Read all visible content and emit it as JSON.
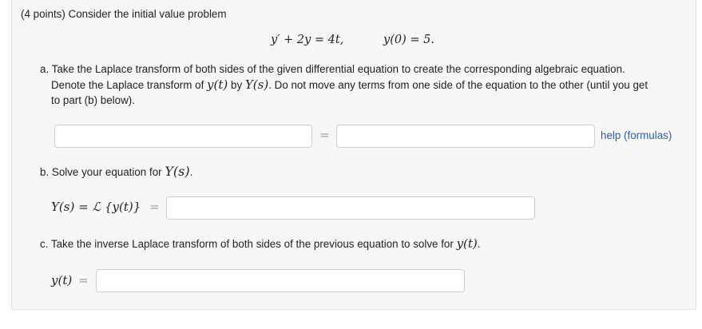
{
  "intro": "(4 points) Consider the initial value problem",
  "ivp": {
    "ode": "y′ + 2y = 4t,",
    "initial": "y(0) = 5."
  },
  "part_a": {
    "line1": "a. Take the Laplace transform of both sides of the given differential equation to create the corresponding algebraic equation.",
    "line2_pre": "Denote the Laplace transform of",
    "y_t": "y(t)",
    "by": "by",
    "Y_s": "Y(s)",
    "line2_post": ". Do not move any terms from one side of the equation to the other (until you get",
    "line3": "to part (b) below).",
    "equals": "=",
    "left_value": "",
    "right_value": "",
    "help_link": "help (formulas)"
  },
  "part_b": {
    "prompt_pre": "b. Solve your equation for",
    "Y_s": "Y(s)",
    "prompt_post": ".",
    "label": "Y(s) = ℒ {y(t)}",
    "equals": "=",
    "value": ""
  },
  "part_c": {
    "prompt_pre": "c. Take the inverse Laplace transform of both sides of the previous equation to solve for",
    "y_t": "y(t)",
    "prompt_post": ".",
    "label": "y(t)",
    "equals": "=",
    "value": ""
  }
}
